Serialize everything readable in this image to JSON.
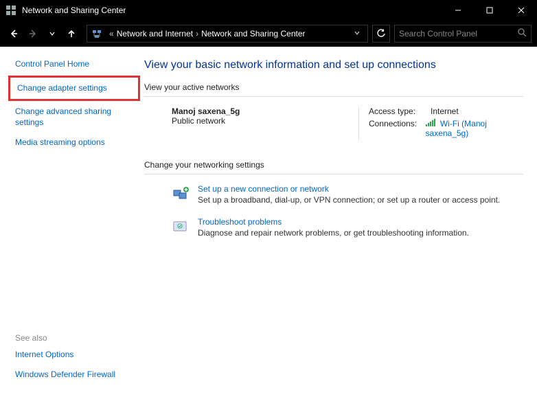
{
  "titleBar": {
    "title": "Network and Sharing Center"
  },
  "breadcrumb": {
    "item1": "Network and Internet",
    "item2": "Network and Sharing Center"
  },
  "search": {
    "placeholder": "Search Control Panel"
  },
  "sidebar": {
    "home": "Control Panel Home",
    "adapter": "Change adapter settings",
    "advanced": "Change advanced sharing settings",
    "media": "Media streaming options",
    "seeAlsoLabel": "See also",
    "internetOptions": "Internet Options",
    "firewall": "Windows Defender Firewall"
  },
  "main": {
    "heading": "View your basic network information and set up connections",
    "activeHeading": "View your active networks",
    "network": {
      "name": "Manoj saxena_5g",
      "type": "Public network",
      "accessTypeLabel": "Access type:",
      "accessTypeValue": "Internet",
      "connectionsLabel": "Connections:",
      "connectionsValue": "Wi-Fi (Manoj saxena_5g)"
    },
    "changeHeading": "Change your networking settings",
    "setup": {
      "title": "Set up a new connection or network",
      "desc": "Set up a broadband, dial-up, or VPN connection; or set up a router or access point."
    },
    "troubleshoot": {
      "title": "Troubleshoot problems",
      "desc": "Diagnose and repair network problems, or get troubleshooting information."
    }
  }
}
